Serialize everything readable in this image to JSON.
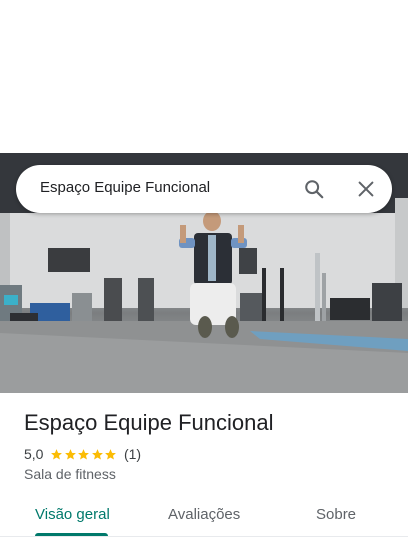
{
  "search": {
    "query": "Espaço Equipe Funcional"
  },
  "place": {
    "title": "Espaço Equipe Funcional",
    "rating": "5,0",
    "stars": 5,
    "review_count": "(1)",
    "category": "Sala de fitness"
  },
  "tabs": [
    {
      "label": "Visão geral",
      "active": true
    },
    {
      "label": "Avaliações",
      "active": false
    },
    {
      "label": "Sobre",
      "active": false
    }
  ],
  "colors": {
    "accent": "#00796b",
    "star": "#fbbc04",
    "text": "#202124",
    "secondary_text": "#5f6368"
  },
  "icons": {
    "search": "search-icon",
    "close": "close-icon",
    "star": "star-icon"
  }
}
